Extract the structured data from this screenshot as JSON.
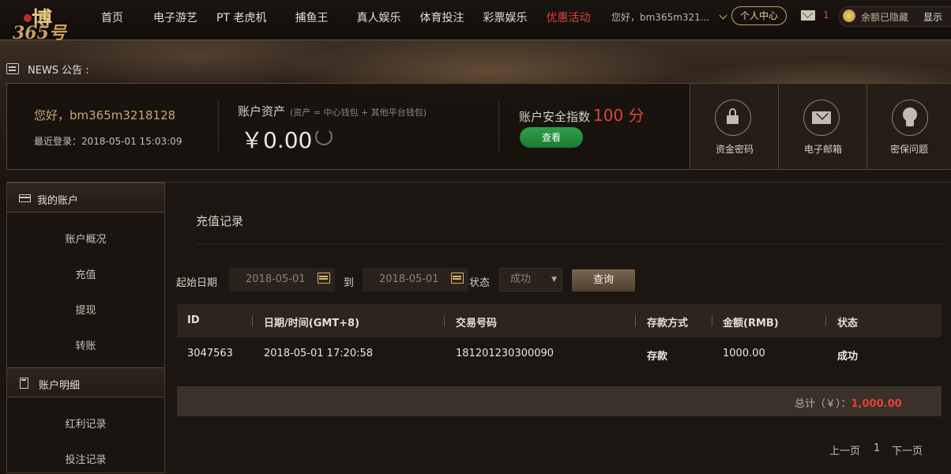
{
  "brand": {
    "logo_top": "博",
    "logo_bottom": "365号"
  },
  "nav": {
    "items": [
      "首页",
      "电子游艺",
      "PT 老虎机",
      "捕鱼王",
      "真人娱乐",
      "体育投注",
      "彩票娱乐",
      "优惠活动"
    ],
    "hot_index": 7
  },
  "header": {
    "hello": "您好，bm365m321...",
    "center_button": "个人中心",
    "mail_count": "1",
    "balance_hidden": "余额已隐藏",
    "show_button": "显示"
  },
  "news": {
    "label": "NEWS 公告 :"
  },
  "account": {
    "greeting": "您好，bm365m3218128",
    "last_login": "最近登录：2018-05-01 15:03:09",
    "assets_title": "账户资产",
    "assets_note": "(资产 = 中心钱包 + 其他平台钱包)",
    "assets_value": "￥0.00",
    "security_title": "账户安全指数",
    "security_score": "100 分",
    "view_button": "查看",
    "tiles": [
      "资金密码",
      "电子邮箱",
      "密保问题"
    ]
  },
  "sidebar": {
    "section1": "我的账户",
    "items1": [
      "账户概况",
      "充值",
      "提现",
      "转账"
    ],
    "section2": "账户明细",
    "items2": [
      "红利记录",
      "投注记录"
    ]
  },
  "main": {
    "title": "充值记录",
    "filter": {
      "start_label": "起始日期",
      "start_value": "2018-05-01",
      "to_label": "到",
      "end_value": "2018-05-01",
      "status_label": "状态",
      "status_value": "成功",
      "query_button": "查询"
    },
    "table": {
      "headers": [
        "ID",
        "日期/时间(GMT+8)",
        "交易号码",
        "存款方式",
        "金额(RMB)",
        "状态"
      ],
      "rows": [
        [
          "3047563",
          "2018-05-01 17:20:58",
          "181201230300090",
          "存款",
          "1000.00",
          "成功"
        ]
      ]
    },
    "total_label": "总计（￥）：",
    "total_value": "1,000.00",
    "pager": {
      "prev": "上一页",
      "page": "1",
      "next": "下一页"
    }
  },
  "colors": {
    "accent_red": "#e0433a",
    "gold": "#c9a45e",
    "green": "#2fa046"
  }
}
